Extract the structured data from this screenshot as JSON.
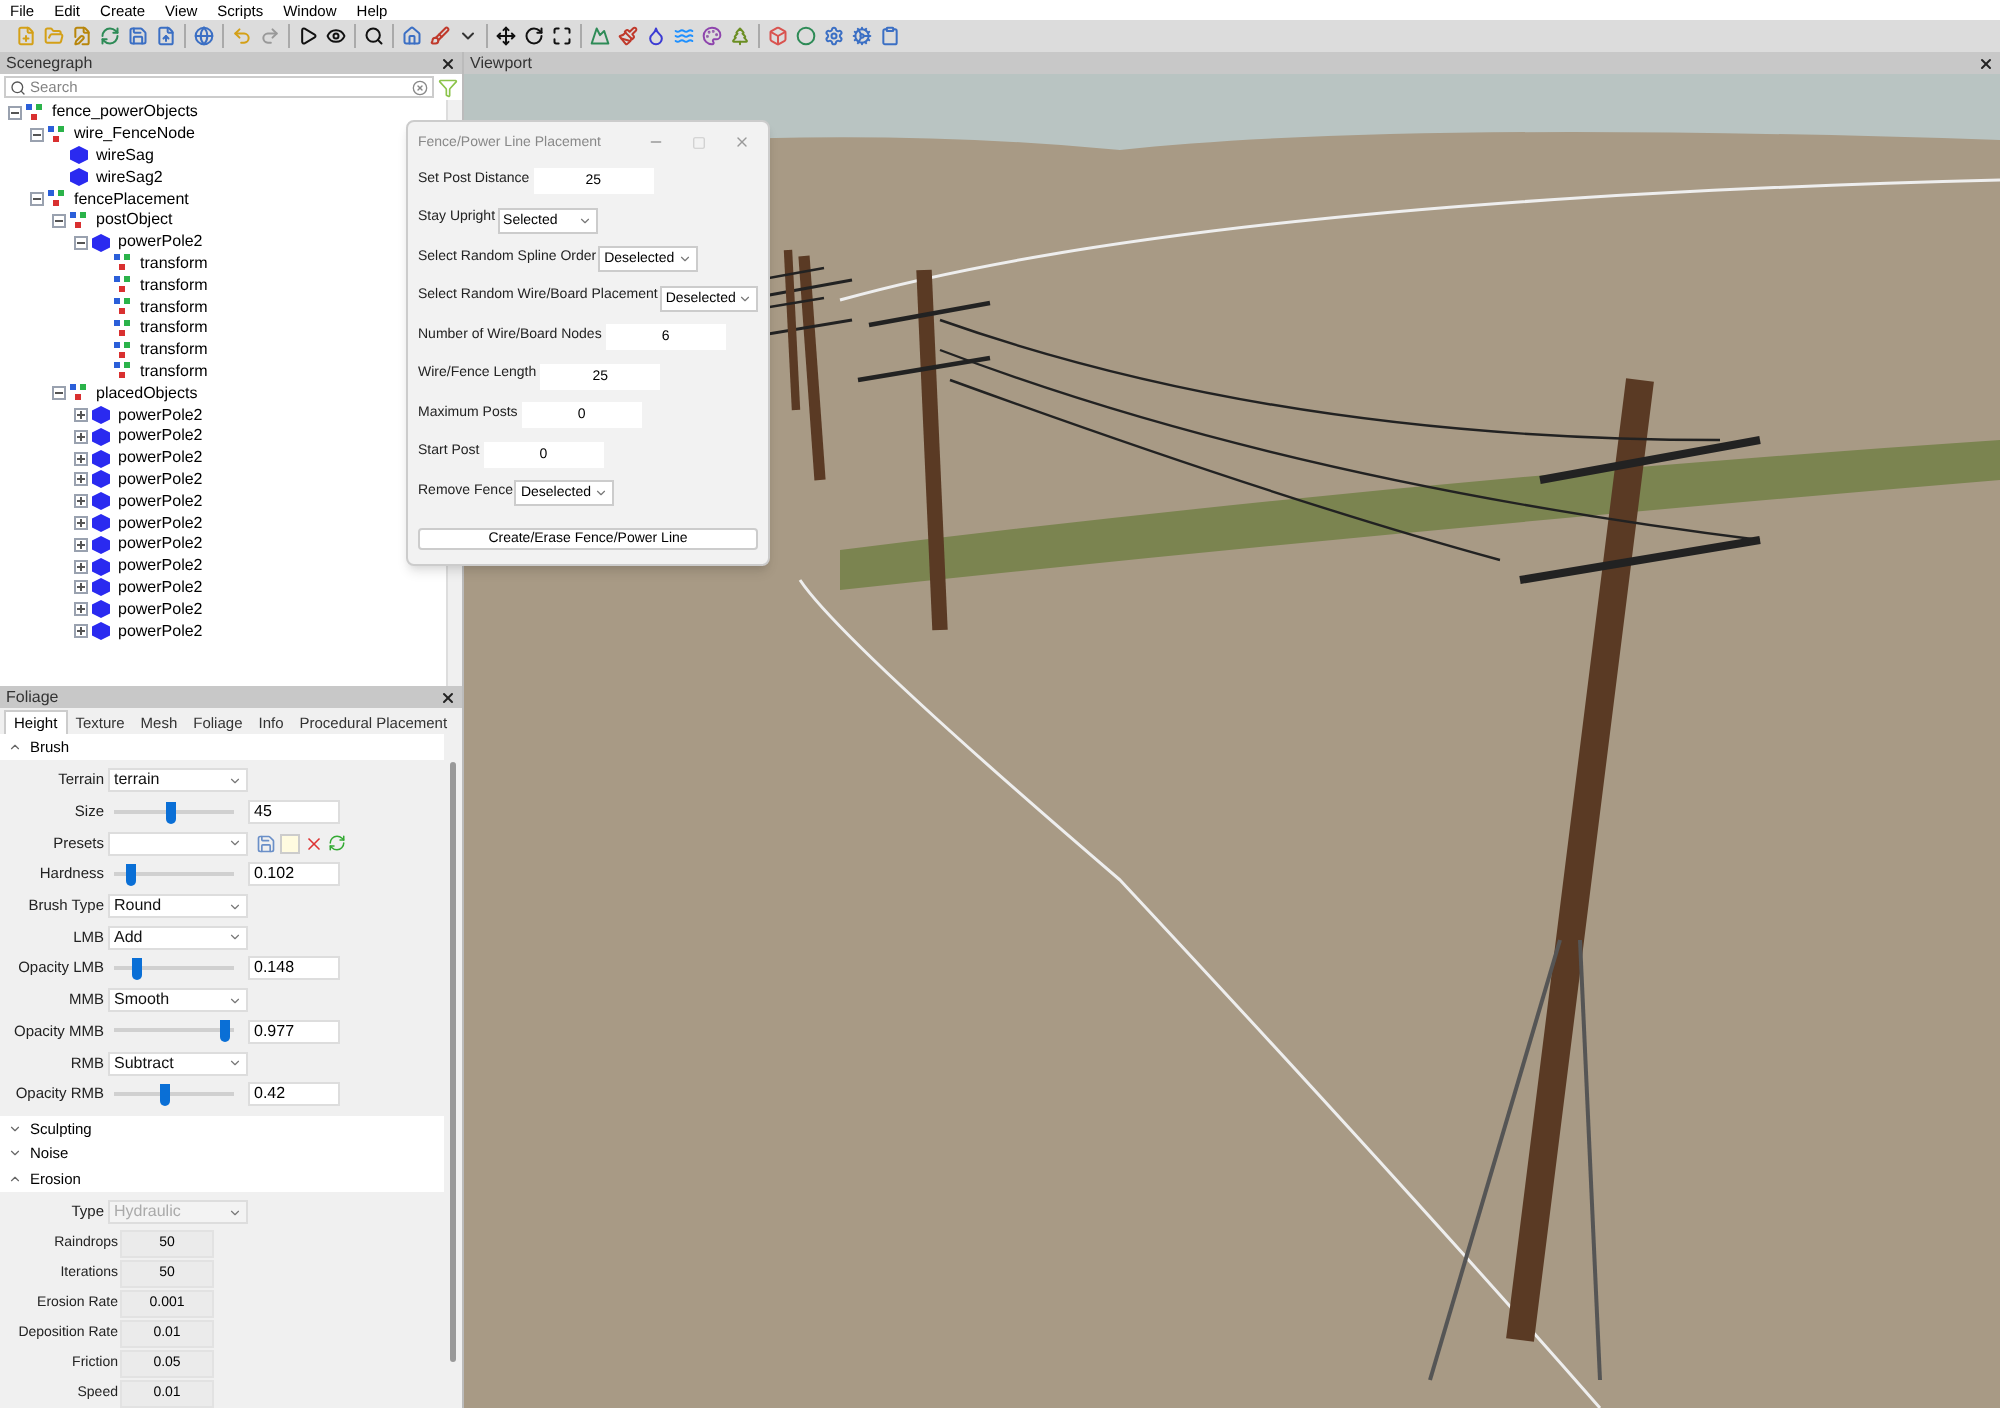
{
  "menu": [
    "File",
    "Edit",
    "Create",
    "View",
    "Scripts",
    "Window",
    "Help"
  ],
  "scenegraph": {
    "title": "Scenegraph",
    "search": {
      "placeholder": "Search"
    },
    "tree": [
      {
        "label": "fence_powerObjects",
        "kind": "group",
        "expanded": true,
        "children": [
          {
            "label": "wire_FenceNode",
            "kind": "group",
            "expanded": true,
            "children": [
              {
                "label": "wireSag",
                "kind": "mesh"
              },
              {
                "label": "wireSag2",
                "kind": "mesh"
              }
            ]
          },
          {
            "label": "fencePlacement",
            "kind": "group",
            "expanded": true,
            "children": [
              {
                "label": "postObject",
                "kind": "group",
                "expanded": true,
                "children": [
                  {
                    "label": "powerPole2",
                    "kind": "mesh",
                    "expanded": true,
                    "children": [
                      {
                        "label": "transform",
                        "kind": "transform"
                      },
                      {
                        "label": "transform",
                        "kind": "transform"
                      },
                      {
                        "label": "transform",
                        "kind": "transform"
                      },
                      {
                        "label": "transform",
                        "kind": "transform"
                      },
                      {
                        "label": "transform",
                        "kind": "transform"
                      },
                      {
                        "label": "transform",
                        "kind": "transform"
                      }
                    ]
                  }
                ]
              },
              {
                "label": "placedObjects",
                "kind": "group",
                "expanded": true,
                "children": [
                  {
                    "label": "powerPole2",
                    "kind": "mesh",
                    "expanded": false
                  },
                  {
                    "label": "powerPole2",
                    "kind": "mesh",
                    "expanded": false
                  },
                  {
                    "label": "powerPole2",
                    "kind": "mesh",
                    "expanded": false
                  },
                  {
                    "label": "powerPole2",
                    "kind": "mesh",
                    "expanded": false
                  },
                  {
                    "label": "powerPole2",
                    "kind": "mesh",
                    "expanded": false
                  },
                  {
                    "label": "powerPole2",
                    "kind": "mesh",
                    "expanded": false
                  },
                  {
                    "label": "powerPole2",
                    "kind": "mesh",
                    "expanded": false
                  },
                  {
                    "label": "powerPole2",
                    "kind": "mesh",
                    "expanded": false
                  },
                  {
                    "label": "powerPole2",
                    "kind": "mesh",
                    "expanded": false
                  },
                  {
                    "label": "powerPole2",
                    "kind": "mesh",
                    "expanded": false
                  },
                  {
                    "label": "powerPole2",
                    "kind": "mesh",
                    "expanded": false
                  }
                ]
              }
            ]
          }
        ]
      }
    ]
  },
  "foliage": {
    "title": "Foliage",
    "tabs": [
      {
        "label": "Height",
        "selected": true
      },
      {
        "label": "Texture",
        "selected": false
      },
      {
        "label": "Mesh",
        "selected": false
      },
      {
        "label": "Foliage",
        "selected": false
      },
      {
        "label": "Info",
        "selected": false
      },
      {
        "label": "Procedural Placement",
        "selected": false
      }
    ],
    "sections": [
      {
        "title": "Brush",
        "expanded": true,
        "rows": [
          {
            "kind": "dropdown",
            "label": "Terrain",
            "value": "terrain"
          },
          {
            "kind": "slider",
            "label": "Size",
            "level": 0.46,
            "value": "45"
          },
          {
            "kind": "presets",
            "label": "Presets"
          },
          {
            "kind": "slider",
            "label": "Hardness",
            "level": 0.14,
            "value": "0.102"
          },
          {
            "kind": "dropdown",
            "label": "Brush Type",
            "value": "Round"
          },
          {
            "kind": "dropdown",
            "label": "LMB",
            "value": "Add"
          },
          {
            "kind": "slider",
            "label": "Opacity LMB",
            "level": 0.19,
            "value": "0.148"
          },
          {
            "kind": "dropdown",
            "label": "MMB",
            "value": "Smooth"
          },
          {
            "kind": "slider",
            "label": "Opacity MMB",
            "level": 0.92,
            "value": "0.977"
          },
          {
            "kind": "dropdown",
            "label": "RMB",
            "value": "Subtract"
          },
          {
            "kind": "slider",
            "label": "Opacity RMB",
            "level": 0.42,
            "value": "0.42"
          }
        ]
      },
      {
        "title": "Sculpting",
        "expanded": false
      },
      {
        "title": "Noise",
        "expanded": false
      },
      {
        "title": "Erosion",
        "expanded": true,
        "rows": [
          {
            "kind": "dropdown",
            "label": "Type",
            "value": "Hydraulic",
            "disabled": true
          },
          {
            "kind": "number",
            "label": "Raindrops",
            "value": "50"
          },
          {
            "kind": "number",
            "label": "Iterations",
            "value": "50"
          },
          {
            "kind": "number",
            "label": "Erosion Rate",
            "value": "0.001"
          },
          {
            "kind": "number",
            "label": "Deposition Rate",
            "value": "0.01"
          },
          {
            "kind": "number",
            "label": "Friction",
            "value": "0.05"
          },
          {
            "kind": "number",
            "label": "Speed",
            "value": "0.01"
          }
        ]
      }
    ]
  },
  "viewport": {
    "title": "Viewport"
  },
  "dialog": {
    "title": "Fence/Power Line Placement",
    "rows": [
      {
        "kind": "input",
        "label": "Set Post Distance",
        "value": "25"
      },
      {
        "kind": "dropdown",
        "label": "Stay Upright",
        "value": "Selected"
      },
      {
        "kind": "dropdown",
        "label": "Select Random Spline Order",
        "value": "Deselected"
      },
      {
        "kind": "dropdown",
        "label": "Select Random Wire/Board Placement",
        "value": "Deselected"
      },
      {
        "kind": "input",
        "label": "Number of Wire/Board Nodes",
        "value": "6"
      },
      {
        "kind": "input",
        "label": "Wire/Fence Length",
        "value": "25"
      },
      {
        "kind": "input",
        "label": "Maximum Posts",
        "value": "0"
      },
      {
        "kind": "input",
        "label": "Start Post",
        "value": "0"
      },
      {
        "kind": "dropdown",
        "label": "Remove Fence",
        "value": "Deselected"
      }
    ],
    "button": "Create/Erase Fence/Power Line"
  }
}
